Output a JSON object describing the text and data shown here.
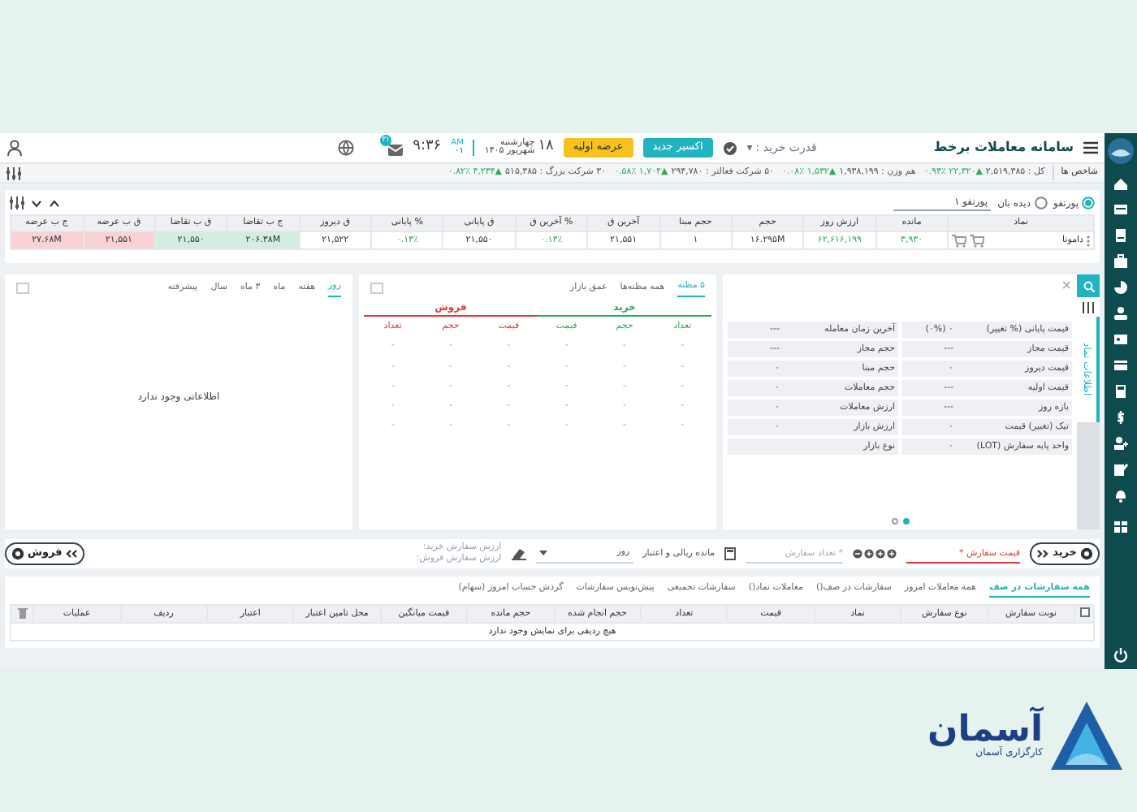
{
  "header": {
    "title": "سامانه معاملات برخط",
    "buying_power": "قدرت خرید :",
    "caret": "▾",
    "buttons": [
      {
        "label": "اکسیر جدید",
        "kind": "teal"
      },
      {
        "label": "عرضه اولیه",
        "kind": "yellow"
      }
    ],
    "day": "۱۸",
    "weekday": "چهارشنبه",
    "month_year": "شهریور ۱۴۰۵",
    "ampm": "AM",
    "seconds": "۰۱",
    "time": "۹:۳۶",
    "badge": "۳۱"
  },
  "indices": {
    "label": "شاخص ها",
    "items": [
      {
        "text": "کل : ۲,۵۱۹,۳۸۵",
        "change": "▲۲۲,۳۲۰ ۰.۹۳٪"
      },
      {
        "text": "هم وزن : ۱,۹۳۸,۱۹۹",
        "change": "▲۱,۵۳۲ ۰.۰۸٪"
      },
      {
        "text": "۵۰ شرکت فعالتر : ۲۹۴,۷۸۰",
        "change": "▲۱,۷۰۴ ۰.۵۸٪"
      },
      {
        "text": "۳۰ شرکت بزرگ : ۵۱۵,۳۸۵",
        "change": "▲۴,۲۳۴ ۰.۸۲٪"
      }
    ]
  },
  "watchlist": {
    "options": [
      {
        "label": "پورتفو",
        "selected": true
      },
      {
        "label": "دیده بان",
        "selected": false
      }
    ],
    "list_name": "پورتفو ۱",
    "columns": [
      "نماد",
      "مانده",
      "ارزش روز",
      "حجم",
      "حجم مبنا",
      "آخرین ق",
      "% آخرین ق",
      "ق پایانی",
      "% پایانی",
      "ق دیروز",
      "ج ب تقاضا",
      "ق ب تقاضا",
      "ق ب عرضه",
      "ج ب عرضه"
    ],
    "rows": [
      {
        "cells": [
          {
            "text": "دامونا",
            "kind": "symbol"
          },
          {
            "text": "۳,۹۳۰",
            "kind": "gain"
          },
          {
            "text": "۶۲,۶۱۶,۱۹۹",
            "kind": "gain"
          },
          {
            "text": "۱۶.۲۹۵M",
            "kind": "plain"
          },
          {
            "text": "۱",
            "kind": "plain"
          },
          {
            "text": "۲۱,۵۵۱",
            "kind": "plain"
          },
          {
            "text": "۰.۱۳٪",
            "kind": "gain"
          },
          {
            "text": "۲۱,۵۵۰",
            "kind": "plain"
          },
          {
            "text": "۰.۱۳٪",
            "kind": "gain"
          },
          {
            "text": "۲۱,۵۲۲",
            "kind": "plain"
          },
          {
            "text": "۲۰۶.۳۸M",
            "kind": "bid"
          },
          {
            "text": "۲۱,۵۵۰",
            "kind": "bid"
          },
          {
            "text": "۲۱,۵۵۱",
            "kind": "ask"
          },
          {
            "text": "۲۷.۶۸M",
            "kind": "ask"
          }
        ]
      }
    ]
  },
  "symbol_info": {
    "tab": "اطلاعات نماد",
    "close": "×",
    "rows": [
      {
        "label": "قیمت پایانی (% تغییر)",
        "value": "۰ (۰%)",
        "label_2": "آخرین زمان معامله",
        "value_2": "---"
      },
      {
        "label": "قیمت مجاز",
        "value": "---",
        "label_2": "حجم مجاز",
        "value_2": "---"
      },
      {
        "label": "قیمت دیروز",
        "value": "۰",
        "label_2": "حجم مبنا",
        "value_2": "۰"
      },
      {
        "label": "قیمت اولیه",
        "value": "---",
        "label_2": "حجم معاملات",
        "value_2": "۰"
      },
      {
        "label": "بازه روز",
        "value": "---",
        "label_2": "ارزش معاملات",
        "value_2": "۰"
      },
      {
        "label": "تیک (تغییر) قیمت",
        "value": "۰",
        "label_2": "ارزش بازار",
        "value_2": "۰"
      },
      {
        "label": "واحد پایه سفارش (LOT)",
        "value": "۰",
        "label_2": "نوع بازار",
        "value_2": ""
      }
    ],
    "pages": [
      {
        "selected": true
      },
      {
        "selected": false
      }
    ]
  },
  "order_book": {
    "tabs": [
      {
        "label": "۵ مظنه",
        "selected": true
      },
      {
        "label": "همه مظنه‌ها",
        "selected": false
      },
      {
        "label": "عمق بازار",
        "selected": false
      }
    ],
    "buy": "خرید",
    "sell": "فروش",
    "buy_columns": [
      "تعداد",
      "حجم",
      "قیمت"
    ],
    "sell_columns": [
      "قیمت",
      "حجم",
      "تعداد"
    ],
    "rows": [
      [
        "-",
        "-",
        "-",
        "-",
        "-",
        "-"
      ],
      [
        "-",
        "-",
        "-",
        "-",
        "-",
        "-"
      ],
      [
        "-",
        "-",
        "-",
        "-",
        "-",
        "-"
      ],
      [
        "-",
        "-",
        "-",
        "-",
        "-",
        "-"
      ],
      [
        "-",
        "-",
        "-",
        "-",
        "-",
        "-"
      ]
    ]
  },
  "chart": {
    "tabs": [
      {
        "label": "روز",
        "selected": true
      },
      {
        "label": "هفته",
        "selected": false
      },
      {
        "label": "ماه",
        "selected": false
      },
      {
        "label": "۳ ماه",
        "selected": false
      },
      {
        "label": "سال",
        "selected": false
      },
      {
        "label": "پیشرفته",
        "selected": false
      }
    ],
    "empty": "اطلاعاتی وجود ندارد"
  },
  "order_bar": {
    "buy": "خرید",
    "price_placeholder": "قیمت سفارش *",
    "qty_placeholder": "* تعداد سفارش",
    "balance": "مانده ریالی و اعتبار",
    "validity": "روز",
    "buy_value": "ارزش سفارش خرید:",
    "sell_value": "ارزش سفارش فروش:",
    "sell": "فروش"
  },
  "orders": {
    "tabs": [
      {
        "label": "همه سفارشات در صف",
        "selected": true
      },
      {
        "label": "همه معاملات امروز",
        "selected": false
      },
      {
        "label": "سفارشات در صف()",
        "selected": false
      },
      {
        "label": "معاملات نماد()",
        "selected": false
      },
      {
        "label": "سفارشات تجمیعی",
        "selected": false
      },
      {
        "label": "پیش‌نویس سفارشات",
        "selected": false
      },
      {
        "label": "گردش حساب امروز (سهام)",
        "selected": false
      }
    ],
    "select_all": {
      "checked": false
    },
    "columns": [
      "نوبت سفارش",
      "نوع سفارش",
      "نماد",
      "قیمت",
      "تعداد",
      "حجم انجام شده",
      "حجم مانده",
      "قیمت میانگین",
      "محل تامین اعتبار",
      "اعتبار",
      "ردیف",
      "عملیات"
    ],
    "empty": "هیچ ردیفی برای نمایش وجود ندارد"
  },
  "brand": {
    "name": "آسمان",
    "tagline": "کارگزاری آسمان"
  }
}
